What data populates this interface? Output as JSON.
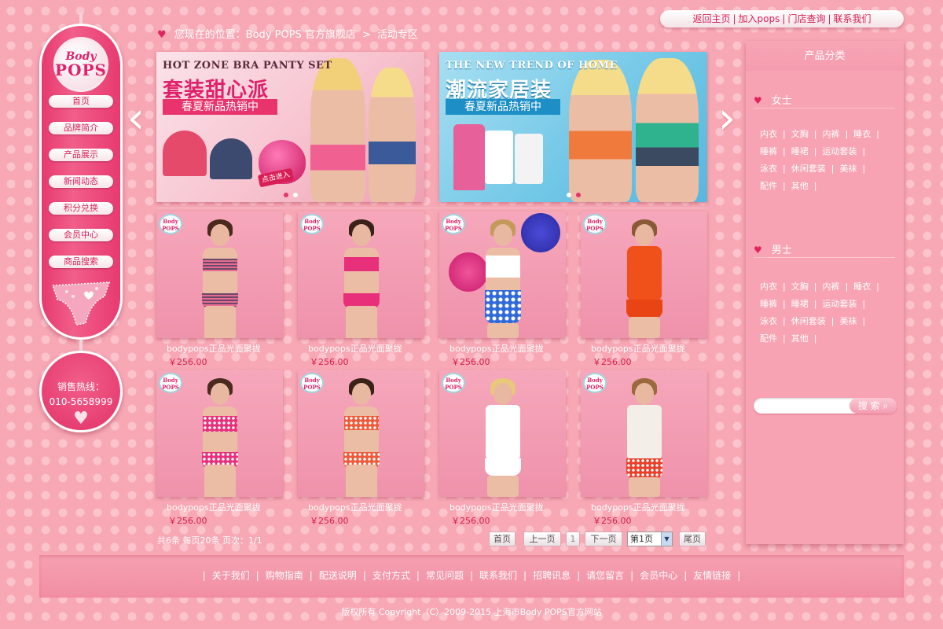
{
  "top_links": [
    "返回主页",
    "加入pops",
    "门店查询",
    "联系我们"
  ],
  "breadcrumb": {
    "prefix": "您现在的位置：",
    "store": "Body POPS 官方旗舰店",
    "separator": ">",
    "current": "活动专区"
  },
  "logo": {
    "line1": "Body",
    "line2": "POPS"
  },
  "nav": [
    "首页",
    "品牌简介",
    "产品展示",
    "新闻动态",
    "积分兑换",
    "会员中心",
    "商品搜索"
  ],
  "hotline": {
    "label": "销售热线：",
    "number": "010-5658999"
  },
  "banners": [
    {
      "en": "HOT ZONE BRA PANTY SET",
      "cn": "套装甜心派",
      "promo": "春夏新品热销中",
      "enter": "点击进入"
    },
    {
      "en": "THE NEW TREND OF HOME",
      "cn": "潮流家居装",
      "promo": "春夏新品热销中",
      "enter": ""
    }
  ],
  "products": [
    {
      "name": "bodypops正品光面聚拢",
      "price": "￥256.00",
      "badge": "Body POPS"
    },
    {
      "name": "bodypops正品光面聚拢",
      "price": "￥256.00",
      "badge": "Body POPS"
    },
    {
      "name": "bodypops正品光面聚拢",
      "price": "￥256.00",
      "badge": "Body POPS"
    },
    {
      "name": "bodypops正品光面聚拢",
      "price": "￥256.00",
      "badge": "Body POPS"
    },
    {
      "name": "bodypops正品光面聚拢",
      "price": "￥256.00",
      "badge": "Body POPS"
    },
    {
      "name": "bodypops正品光面聚拢",
      "price": "￥256.00",
      "badge": "Body POPS"
    },
    {
      "name": "bodypops正品光面聚拢",
      "price": "￥256.00",
      "badge": "Body POPS"
    },
    {
      "name": "bodypops正品光面聚拢",
      "price": "￥256.00",
      "badge": "Body POPS"
    }
  ],
  "pagination": {
    "info": "共6条  每页20条  页次：1/1",
    "first": "首页",
    "prev": "上一页",
    "current": "1",
    "next": "下一页",
    "select_value": "第1页",
    "last": "尾页"
  },
  "sidebar_right": {
    "title": "产品分类",
    "women": {
      "title": "女士",
      "items": [
        "内衣",
        "文胸",
        "内裤",
        "睡衣",
        "睡裤",
        "睡裙",
        "运动套装",
        "泳衣",
        "休闲套装",
        "美袜",
        "配件",
        "其他"
      ]
    },
    "men": {
      "title": "男士",
      "items": [
        "内衣",
        "文胸",
        "内裤",
        "睡衣",
        "睡裤",
        "睡裙",
        "运动套装",
        "泳衣",
        "休闲套装",
        "美袜",
        "配件",
        "其他"
      ]
    },
    "search": {
      "button": "搜 索",
      "value": ""
    }
  },
  "footer": {
    "links": [
      "关于我们",
      "购物指南",
      "配送说明",
      "支付方式",
      "常见问题",
      "联系我们",
      "招聘讯息",
      "请您留言",
      "会员中心",
      "友情链接"
    ],
    "copyright": "版权所有  Copyright（C）2009-2015  上海市Body POPS官方网站"
  },
  "colors": {
    "accent": "#d81e55",
    "background": "#f7a8b4",
    "panel": "#f8a3b3"
  },
  "icons": {
    "heart": "heart-icon",
    "search": "search-icon",
    "arrow_left": "chevron-left-icon",
    "arrow_right": "chevron-right-icon"
  }
}
